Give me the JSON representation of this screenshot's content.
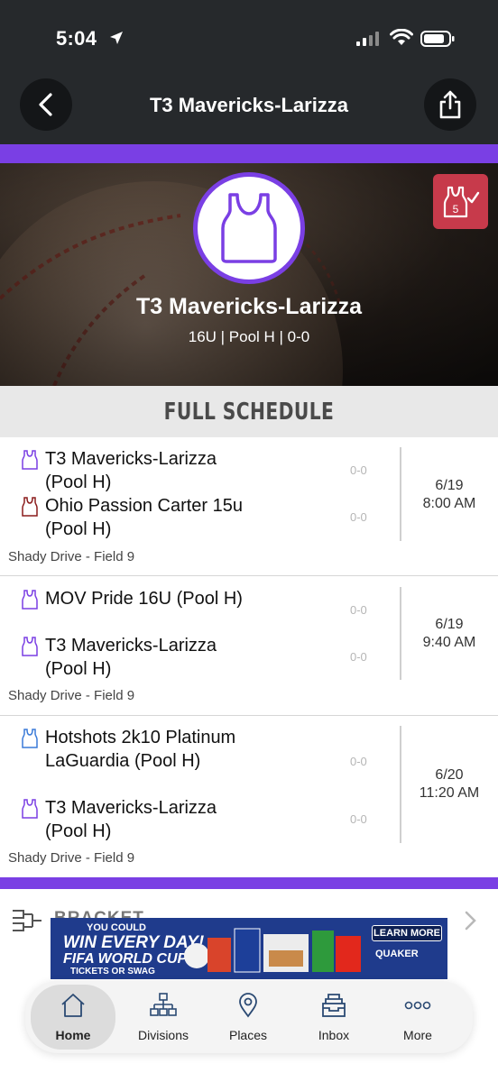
{
  "status_bar": {
    "time": "5:04"
  },
  "header": {
    "title": "T3 Mavericks-Larizza"
  },
  "hero": {
    "team_name": "T3 Mavericks-Larizza",
    "subtitle": "16U | Pool H | 0-0",
    "badge_number": "5"
  },
  "schedule": {
    "heading": "FULL SCHEDULE",
    "games": [
      {
        "team1": {
          "name": "T3 Mavericks-Larizza (Pool H)",
          "score": "0-0",
          "jersey_color": "#7a3fe4"
        },
        "team2": {
          "name": "Ohio Passion Carter 15u (Pool H)",
          "score": "0-0",
          "jersey_color": "#8b1c1c"
        },
        "date": "6/19",
        "time": "8:00 AM",
        "venue": "Shady Drive - Field 9"
      },
      {
        "team1": {
          "name": "MOV Pride 16U (Pool H)",
          "score": "0-0",
          "jersey_color": "#7a3fe4"
        },
        "team2": {
          "name": "T3 Mavericks-Larizza (Pool H)",
          "score": "0-0",
          "jersey_color": "#7a3fe4"
        },
        "date": "6/19",
        "time": "9:40 AM",
        "venue": "Shady Drive - Field 9"
      },
      {
        "team1": {
          "name": "Hotshots 2k10 Platinum LaGuardia (Pool H)",
          "score": "0-0",
          "jersey_color": "#3a7ad8"
        },
        "team2": {
          "name": "T3 Mavericks-Larizza (Pool H)",
          "score": "0-0",
          "jersey_color": "#7a3fe4"
        },
        "date": "6/20",
        "time": "11:20 AM",
        "venue": "Shady Drive - Field 9"
      }
    ]
  },
  "bracket": {
    "label": "BRACKET"
  },
  "ad": {
    "line1": "YOU COULD",
    "line2": "WIN EVERY DAY!",
    "line3": "FIFA WORLD CUP 26",
    "line4": "TICKETS OR SWAG",
    "button": "LEARN MORE",
    "brand": "QUAKER"
  },
  "nav": {
    "items": [
      {
        "label": "Home",
        "icon": "home-icon",
        "active": true
      },
      {
        "label": "Divisions",
        "icon": "divisions-icon"
      },
      {
        "label": "Places",
        "icon": "places-icon"
      },
      {
        "label": "Inbox",
        "icon": "inbox-icon"
      },
      {
        "label": "More",
        "icon": "more-icon"
      }
    ]
  },
  "colors": {
    "accent": "#7a3fe4",
    "badge": "#c73a4b",
    "header_bg": "#26292c"
  }
}
